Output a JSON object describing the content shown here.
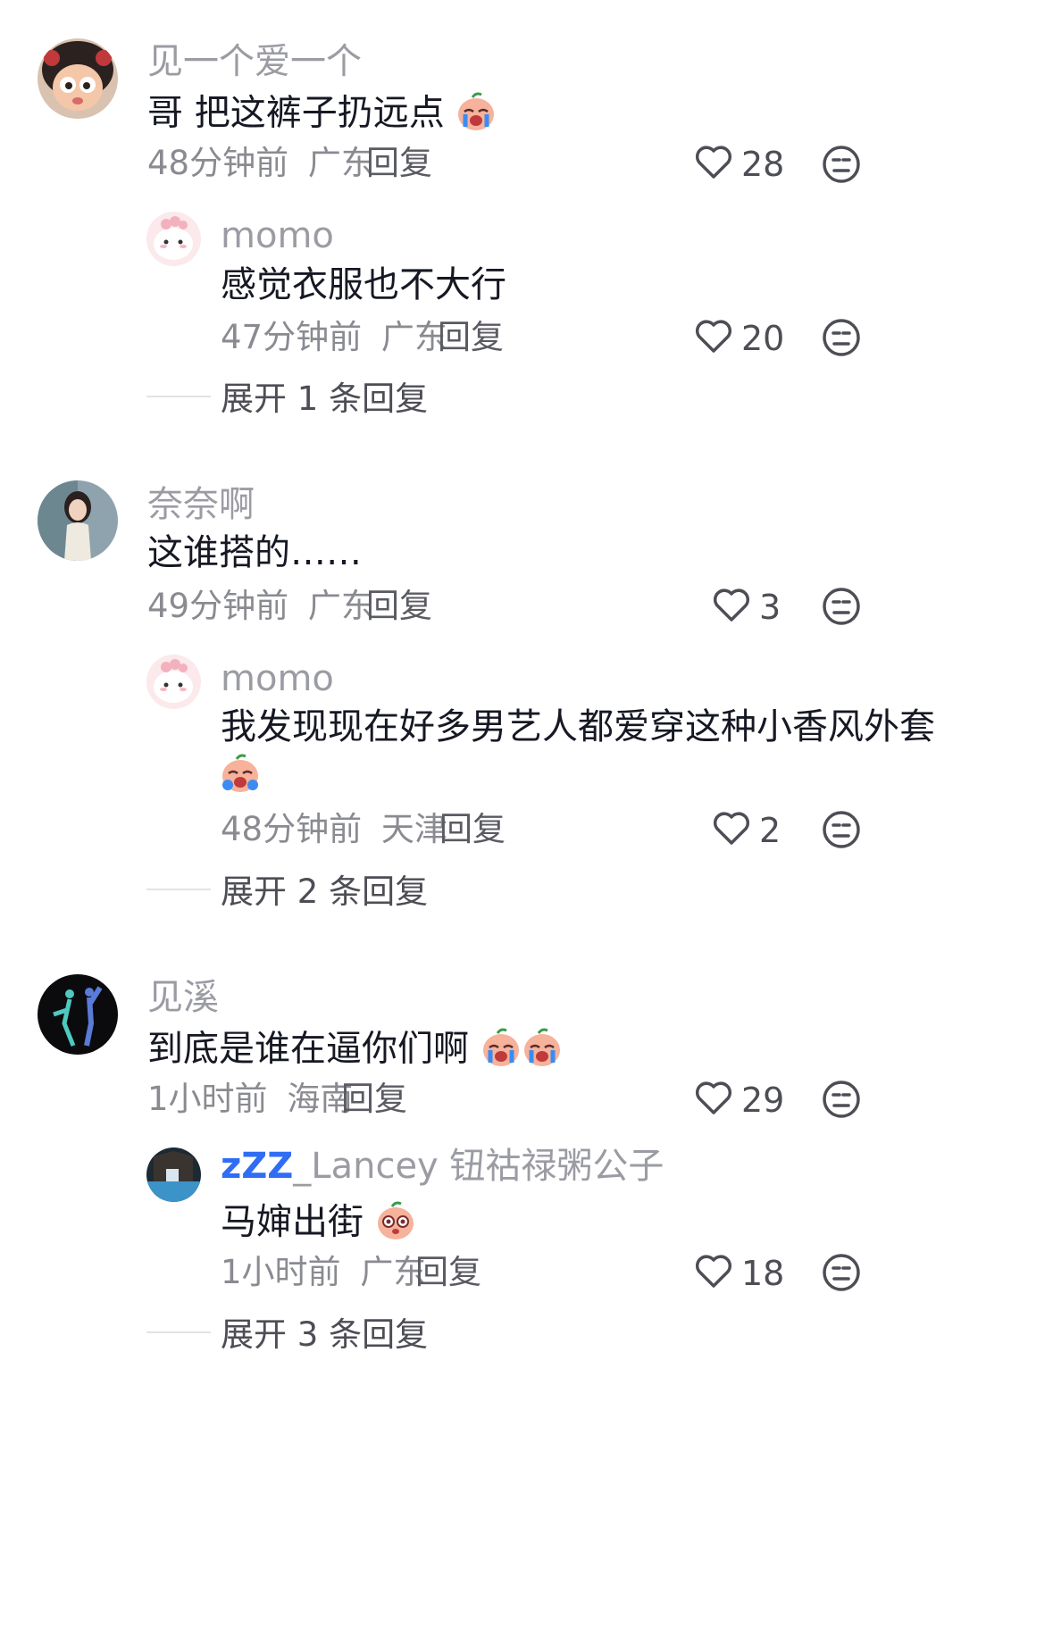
{
  "comments": [
    {
      "user": "见一个爱一个",
      "text": "哥 把这裤子扔远点",
      "emoji_after": "crying-face-emoji",
      "time": "48分钟前",
      "location": "广东",
      "reply_label": "回复",
      "likes": "28",
      "replies": [
        {
          "user": "momo",
          "text": "感觉衣服也不大行",
          "time": "47分钟前",
          "location": "广东",
          "reply_label": "回复",
          "likes": "20"
        }
      ],
      "expand_label": "展开 1 条回复"
    },
    {
      "user": "奈奈啊",
      "text": "这谁搭的……",
      "time": "49分钟前",
      "location": "广东",
      "reply_label": "回复",
      "likes": "3",
      "replies": [
        {
          "user": "momo",
          "text": "我发现现在好多男艺人都爱穿这种小香风外套",
          "emoji_after": "crying-face-emoji",
          "time": "48分钟前",
          "location": "天津",
          "reply_label": "回复",
          "likes": "2"
        }
      ],
      "expand_label": "展开 2 条回复"
    },
    {
      "user": "见溪",
      "text": "到底是谁在逼你们啊",
      "emoji_after": "crying-face-emoji x2",
      "time": "1小时前",
      "location": "海南",
      "reply_label": "回复",
      "likes": "29",
      "replies": [
        {
          "user_prefix": "zZZ",
          "user": "_Lancey 钮祜禄粥公子",
          "text": "马婶出街",
          "emoji_after": "pleading-face-emoji",
          "time": "1小时前",
          "location": "广东",
          "reply_label": "回复",
          "likes": "18"
        }
      ],
      "expand_label": "展开 3 条回复"
    }
  ],
  "colors": {
    "text": "#161823",
    "username": "#9b9ca3",
    "meta": "#8a8b91",
    "emoji_face": "#f6b29b",
    "tear": "#3b8cf2",
    "zzz": "#2f6df5"
  },
  "icons": [
    "heart-outline-icon",
    "meh-face-icon"
  ]
}
